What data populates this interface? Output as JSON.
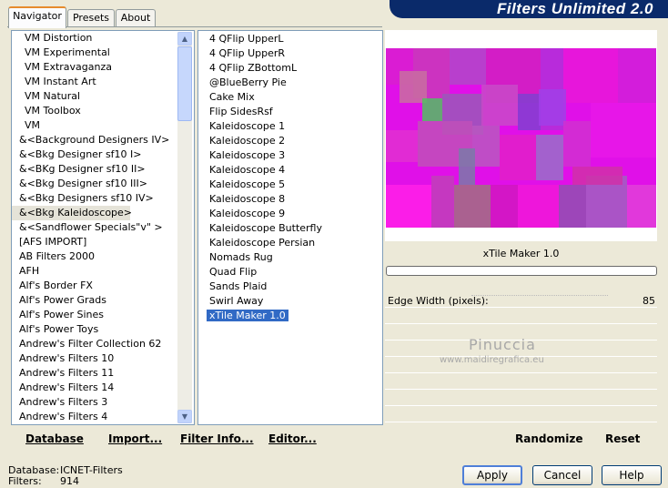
{
  "header": {
    "title": "Filters Unlimited 2.0"
  },
  "tabs": [
    {
      "label": "Navigator",
      "active": true
    },
    {
      "label": "Presets",
      "active": false
    },
    {
      "label": "About",
      "active": false
    }
  ],
  "categories": [
    "VM Distortion",
    "VM Experimental",
    "VM Extravaganza",
    "VM Instant Art",
    "VM Natural",
    "VM Toolbox",
    "VM",
    "&<Background Designers IV>",
    "&<Bkg Designer sf10 I>",
    "&<BKg Designer sf10 II>",
    "&<Bkg Designer sf10 III>",
    "&<Bkg Designers sf10 IV>",
    "&<Bkg Kaleidoscope>",
    "&<Sandflower Specials\"v\" >",
    "[AFS IMPORT]",
    "AB Filters 2000",
    "AFH",
    "Alf's Border FX",
    "Alf's Power Grads",
    "Alf's Power Sines",
    "Alf's Power Toys",
    "Andrew's Filter Collection 62",
    "Andrew's Filters 10",
    "Andrew's Filters 11",
    "Andrew's Filters 14",
    "Andrew's Filters 3",
    "Andrew's Filters 4"
  ],
  "filters": [
    "4 QFlip UpperL",
    "4 QFlip UpperR",
    "4 QFlip ZBottomL",
    "@BlueBerry Pie",
    "Cake Mix",
    "Flip SidesRsf",
    "Kaleidoscope 1",
    "Kaleidoscope 2",
    "Kaleidoscope 3",
    "Kaleidoscope 4",
    "Kaleidoscope 5",
    "Kaleidoscope 8",
    "Kaleidoscope 9",
    "Kaleidoscope Butterfly",
    "Kaleidoscope Persian",
    "Nomads Rug",
    "Quad Flip",
    "Sands Plaid",
    "Swirl Away",
    "xTile Maker 1.0"
  ],
  "selected_filter": "xTile Maker 1.0",
  "preview": {
    "filter_name": "xTile Maker 1.0"
  },
  "params": [
    {
      "label": "Edge Width (pixels):",
      "value": "85"
    }
  ],
  "watermark": {
    "line1": "Pinuccia",
    "line2": "www.maidiregrafica.eu"
  },
  "toolbar": {
    "database": "Database",
    "import": "Import...",
    "filter_info": "Filter Info...",
    "editor": "Editor...",
    "randomize": "Randomize",
    "reset": "Reset"
  },
  "status": {
    "database_label": "Database:",
    "database_value": "ICNET-Filters",
    "filters_label": "Filters:",
    "filters_value": "914"
  },
  "buttons": {
    "apply": "Apply",
    "cancel": "Cancel",
    "help": "Help"
  },
  "colors": {
    "banner": "#0a2a6a",
    "selection": "#316ac5",
    "preview_base": "#e010e8"
  }
}
